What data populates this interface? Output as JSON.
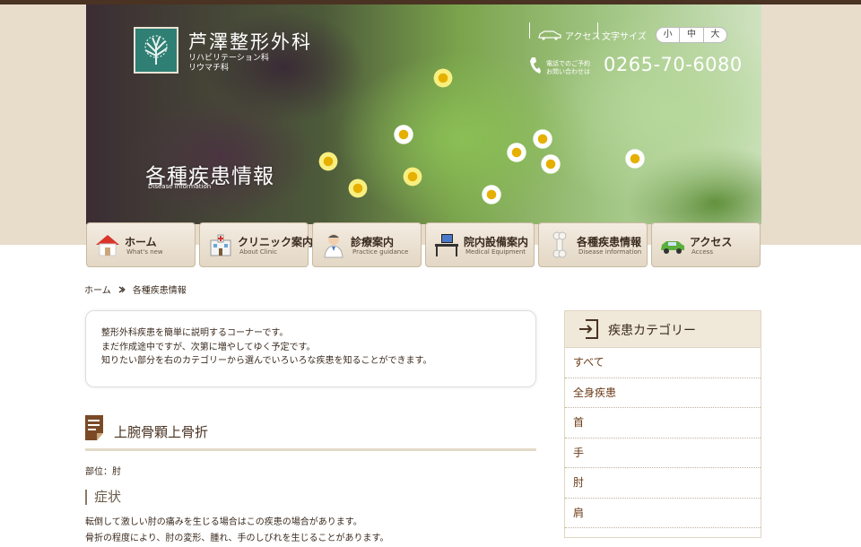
{
  "header": {
    "logo_title": "芦澤整形外科",
    "logo_sub1": "リハビリテーション科",
    "logo_sub2": "リウマチ科",
    "access_label": "アクセス",
    "fontsize_label": "文字サイズ",
    "fontsize_options": [
      "小",
      "中",
      "大"
    ],
    "phone_label1": "電話でのご予約",
    "phone_label2": "お問い合わせは",
    "phone_number": "0265-70-6080",
    "page_title": "各種疾患情報",
    "page_title_en": "Disease information"
  },
  "nav": [
    {
      "label": "ホーム",
      "en": "What's new",
      "icon": "house-icon"
    },
    {
      "label": "クリニック案内",
      "en": "About Clinic",
      "icon": "clinic-building-icon"
    },
    {
      "label": "診療案内",
      "en": "Practice guidance",
      "icon": "doctor-icon"
    },
    {
      "label": "院内設備案内",
      "en": "Medical Equipment",
      "icon": "equipment-icon"
    },
    {
      "label": "各種疾患情報",
      "en": "Disease information",
      "icon": "bone-icon"
    },
    {
      "label": "アクセス",
      "en": "Access",
      "icon": "car-icon"
    }
  ],
  "breadcrumb": {
    "home": "ホーム",
    "current": "各種疾患情報"
  },
  "intro": {
    "line1": "整形外科疾患を簡単に説明するコーナーです。",
    "line2": "まだ作成途中ですが、次第に増やしてゆく予定です。",
    "line3": "知りたい部分を右のカテゴリーから選んでいろいろな疾患を知ることができます。"
  },
  "article": {
    "title": "上腕骨顆上骨折",
    "part": "部位：肘",
    "symptom_heading": "症状",
    "symptom_line1": "転倒して激しい肘の痛みを生じる場合はこの疾患の場合があります。",
    "symptom_line2": "骨折の程度により、肘の変形、腫れ、手のしびれを生じることがあります。"
  },
  "sidebar": {
    "title": "疾患カテゴリー",
    "items": [
      "すべて",
      "全身疾患",
      "首",
      "手",
      "肘",
      "肩"
    ]
  },
  "colors": {
    "brand_dark": "#4a3322",
    "beige": "#e8dccb",
    "logo_teal": "#2f7f74",
    "link": "#6b3a16"
  }
}
